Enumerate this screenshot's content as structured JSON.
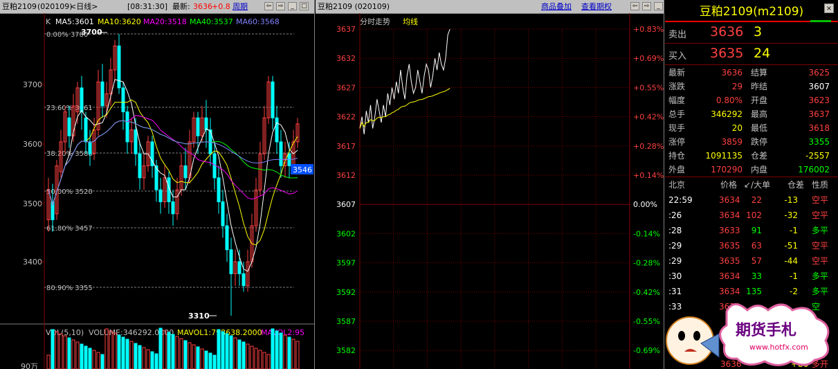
{
  "kline": {
    "title_symbol": "豆粕2109",
    "title_code": "(020109)",
    "title_period": "<日线>",
    "time": "[08:31:30]",
    "latest_label": "最新:",
    "latest_value": "3636",
    "change": "+0.8",
    "period_link": "周期",
    "indicator_label": "K",
    "ma": [
      {
        "label": "MA5:3601",
        "color": "#ffffff"
      },
      {
        "label": "MA10:3620",
        "color": "#ffff00"
      },
      {
        "label": "MA20:3518",
        "color": "#ff00ff"
      },
      {
        "label": "MA40:3537",
        "color": "#00ff00"
      },
      {
        "label": "MA60:3568",
        "color": "#8080ff"
      }
    ],
    "price_ticks": [
      "3700",
      "3600",
      "3500",
      "3400"
    ],
    "fib_levels": [
      "0.00% 3780",
      "23.60% 3661",
      "38.20% 3588",
      "50.00% 3520",
      "61.80% 3457",
      "80.90% 3355"
    ],
    "high_mark": "3700",
    "low_mark": "3310",
    "current_tag": "3546",
    "vol_label": "VOL(5,10)",
    "vol_text": "VOLUME:346292.0000",
    "mavol1": "MAVOL1:798638.2000",
    "mavol2": "MAVOL2:95",
    "vol_axis": "90万"
  },
  "timechart": {
    "title": "豆粕2109 (020109)",
    "link1": "商品叠加",
    "link2": "查看期权",
    "label_flow": "分时走势",
    "label_avg": "均线",
    "price_ticks": [
      "3637",
      "3632",
      "3627",
      "3622",
      "3617",
      "3612",
      "3607",
      "3602",
      "3597",
      "3592",
      "3587",
      "3582"
    ],
    "pct_ticks": [
      "+0.83%",
      "+0.69%",
      "+0.55%",
      "+0.42%",
      "+0.28%",
      "+0.14%",
      "0.00%",
      "-0.14%",
      "-0.28%",
      "-0.42%",
      "-0.55%",
      "-0.69%"
    ]
  },
  "quote": {
    "title": "豆粕2109(m2109)",
    "sell_label": "卖出",
    "sell_price": "3636",
    "sell_qty": "3",
    "buy_label": "买入",
    "buy_price": "3635",
    "buy_qty": "24",
    "stats": [
      {
        "l1": "最新",
        "v1": "3636",
        "c1": "#ff4040",
        "l2": "结算",
        "v2": "3625",
        "c2": "#ff4040"
      },
      {
        "l1": "涨跌",
        "v1": "29",
        "c1": "#ff4040",
        "l2": "昨结",
        "v2": "3607",
        "c2": "#ffffff"
      },
      {
        "l1": "幅度",
        "v1": "0.80%",
        "c1": "#ff4040",
        "l2": "开盘",
        "v2": "3623",
        "c2": "#ff4040"
      },
      {
        "l1": "总手",
        "v1": "346292",
        "c1": "#ffff00",
        "l2": "最高",
        "v2": "3637",
        "c2": "#ff4040"
      },
      {
        "l1": "现手",
        "v1": "20",
        "c1": "#ffff00",
        "l2": "最低",
        "v2": "3618",
        "c2": "#ff4040"
      },
      {
        "l1": "涨停",
        "v1": "3859",
        "c1": "#ff4040",
        "l2": "跌停",
        "v2": "3355",
        "c2": "#00ff00"
      },
      {
        "l1": "持仓",
        "v1": "1091135",
        "c1": "#ffff00",
        "l2": "仓差",
        "v2": "-2557",
        "c2": "#ffff00"
      },
      {
        "l1": "外盘",
        "v1": "170290",
        "c1": "#ff4040",
        "l2": "内盘",
        "v2": "176002",
        "c2": "#00ff00"
      }
    ],
    "tick_header": {
      "h1": "北京",
      "h2": "价格",
      "h3": "↙/大单",
      "h4": "仓差",
      "h5": "性质"
    },
    "ticks": [
      {
        "time": "22:59",
        "price": "3634",
        "vol": "22",
        "volc": "#ff4040",
        "diff": "-13",
        "type": "空平",
        "typec": "#ff4040"
      },
      {
        "time": ":26",
        "price": "3634",
        "vol": "102",
        "volc": "#ff4040",
        "diff": "-32",
        "type": "空平",
        "typec": "#ff4040"
      },
      {
        "time": ":28",
        "price": "3633",
        "vol": "91",
        "volc": "#00ff00",
        "diff": "-1",
        "type": "多平",
        "typec": "#00ff00"
      },
      {
        "time": ":29",
        "price": "3635",
        "vol": "63",
        "volc": "#ff4040",
        "diff": "-51",
        "type": "空平",
        "typec": "#ff4040"
      },
      {
        "time": ":29",
        "price": "3635",
        "vol": "57",
        "volc": "#ff4040",
        "diff": "-44",
        "type": "空平",
        "typec": "#ff4040"
      },
      {
        "time": ":30",
        "price": "3634",
        "vol": "33",
        "volc": "#00ff00",
        "diff": "-1",
        "type": "多平",
        "typec": "#00ff00"
      },
      {
        "time": ":31",
        "price": "3634",
        "vol": "135",
        "volc": "#00ff00",
        "diff": "-2",
        "type": "多平",
        "typec": "#00ff00"
      },
      {
        "time": ":33",
        "price": "3634",
        "vol": "",
        "volc": "#00ff00",
        "diff": "",
        "type": "空",
        "typec": "#00ff00"
      }
    ],
    "last_partial": {
      "price": "3636",
      "diff": "+80",
      "type": "多开"
    }
  },
  "watermark": {
    "text": "期货手札",
    "url": "www.hotfx.com"
  }
}
